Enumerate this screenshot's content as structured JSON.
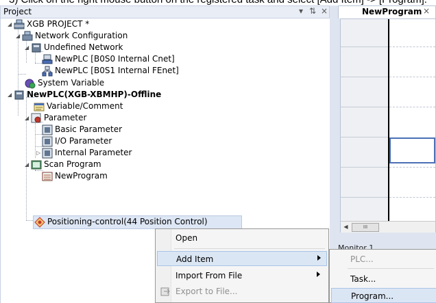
{
  "caption": "3) Click on the right mouse button on the registered task and select [Add Item] -> [Program].",
  "panel": {
    "title": "Project",
    "pin": "↓ ↕ ×"
  },
  "tree": {
    "project": "XGB PROJECT *",
    "network_config": "Network Configuration",
    "undefined_network": "Undefined Network",
    "plc_cnet": "NewPLC [B0S0 Internal Cnet]",
    "plc_fenet": "NewPLC [B0S1 Internal FEnet]",
    "system_variable": "System Variable",
    "plc": "NewPLC(XGB-XBMHP)-Offline",
    "variable_comment": "Variable/Comment",
    "parameter": "Parameter",
    "basic_parameter": "Basic Parameter",
    "io_parameter": "I/O Parameter",
    "internal_parameter": "Internal Parameter",
    "scan_program": "Scan Program",
    "new_program": "NewProgram",
    "positioning": "Positioning-control(44 Position Control)"
  },
  "editor": {
    "tab": "NewProgram",
    "tab_close": "×",
    "scroll_thumb": "III",
    "monitor": "Monitor 1"
  },
  "context_menu": {
    "open": "Open",
    "add_item": "Add Item",
    "import_from_file": "Import From File",
    "export_to_file": "Export to File..."
  },
  "submenu": {
    "plc": "PLC...",
    "task": "Task...",
    "program": "Program..."
  },
  "colors": {
    "highlight": "#dbe6f4",
    "panel_header": "#e8edf6",
    "selection_border": "#4a6fb5"
  }
}
